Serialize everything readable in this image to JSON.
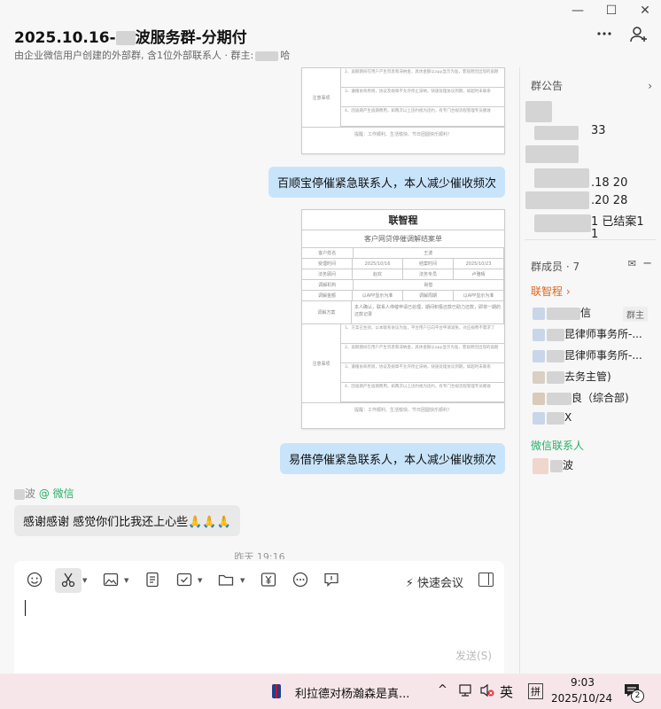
{
  "window": {
    "controls": [
      "—",
      "☐",
      "✕"
    ]
  },
  "header": {
    "title_prefix": "2025.10.16-",
    "title_suffix": "波服务群-分期付",
    "subtitle_prefix": "由企业微信用户创建的外部群, 含1位外部联系人 · 群主:",
    "subtitle_suffix": "哈",
    "more_icon": "more-icon",
    "add_member_icon": "add-member-icon"
  },
  "messages": {
    "doc1": {
      "notes_label": "注意事项",
      "lines": [
        "2、逾期期间在用户产生罚息和滞纳金，具体金额以app显示为准，客观原因出现的逾期",
        "3、遵循协商原则，协议及规章不允许停止滞纳，快速处理协议到期，如超时未联系",
        "4、因逾期产生逾期费用，如两次以上违约视为违约，有专门合规流程管理专员催收"
      ],
      "footer": "提醒：工作顺利、生活愉快、节日团圆快乐顺利！"
    },
    "bubble1": "百顺宝停催紧急联系人，本人减少催收频次",
    "doc2": {
      "title": "联智程",
      "subtitle": "客户网贷停催调解结案单",
      "rows": [
        [
          "客户姓名",
          "王波"
        ],
        [
          "受理时间",
          "2025/10/16",
          "结案时间",
          "2025/10/23"
        ],
        [
          "法务顾问",
          "赵欢",
          "法务专员",
          "卢雅晴"
        ],
        [
          "调解机构",
          "易借"
        ],
        [
          "调解金额",
          "以APP显示为准",
          "调解周期",
          "以APP显示为准"
        ],
        [
          "调解方案",
          "本人确认，联系人停催申请已处理，期间积极还款已助力还款，即将一期的还款记录"
        ]
      ],
      "notes_label": "注意事项",
      "lines": [
        "1、方案已生效，以本联系协议为准，平台用户已向平台申请减免，对应规费不需求了",
        "2、逾期期间在用户产生罚息和滞纳金，具体金额以app显示为准，客观原因出现的逾期",
        "3、遵循协商原则，协议及规章不允许停止滞纳，快速处理协议到期，如超时未联系",
        "4、因逾期产生逾期费用，如两次以上违约视为违约，有专门合规流程管理专员催收"
      ],
      "footer": "提醒：工作顺利、生活愉快、节日团圆快乐顺利！"
    },
    "bubble2": "易借停催紧急联系人，本人减少催收频次",
    "sender_suffix": "波",
    "sender_source": "@ 微信",
    "bubble3": "感谢感谢  感觉你们比我还上心些🙏🙏🙏",
    "timestamp": "昨天 19:16"
  },
  "composer": {
    "meeting_label": "快速会议",
    "send_label": "发送(S)",
    "tools": [
      "emoji-icon",
      "scissors-icon",
      "image-icon",
      "document-icon",
      "task-icon",
      "folder-icon",
      "transfer-icon",
      "more-circle-icon",
      "message-icon"
    ]
  },
  "sidebar": {
    "announcement_title": "群公告",
    "announcement_lines": [
      "33",
      ".18  20",
      ".20  28",
      "1 已结案1",
      "1"
    ],
    "members_title": "群成员 · 7",
    "company_label": "联智程 ›",
    "members": [
      {
        "name": "信",
        "badge": "群主"
      },
      {
        "name": "昆律师事务所-..."
      },
      {
        "name": "昆律师事务所-..."
      },
      {
        "name": "去务主管)"
      },
      {
        "name": "良（综合部)"
      },
      {
        "name": "X"
      }
    ],
    "wechat_title": "微信联系人",
    "wechat_member": "波"
  },
  "taskbar": {
    "news": "利拉德对杨瀚森是真...",
    "ime_lang": "英",
    "ime_mode": "拼",
    "time": "9:03",
    "date": "2025/10/24",
    "notif_count": "2"
  },
  "colors": {
    "bubble_me": "#c8e4fa",
    "bubble_other": "#e9e9e9",
    "accent_orange": "#e0651c",
    "wechat_green": "#2aae67",
    "taskbar": "#f6e6ea"
  }
}
